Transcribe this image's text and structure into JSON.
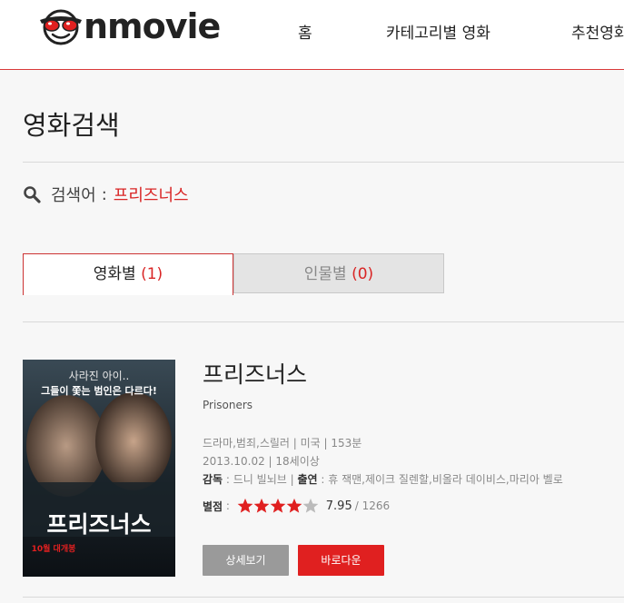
{
  "header": {
    "logo_text": "nmovie",
    "nav": {
      "home": "홈",
      "category": "카테고리별 영화",
      "recommend": "추천영화"
    }
  },
  "page": {
    "title": "영화검색"
  },
  "search": {
    "label": "검색어",
    "separator": ":",
    "term": "프리즈너스"
  },
  "tabs": [
    {
      "label": "영화별",
      "count": "(1)",
      "active": true
    },
    {
      "label": "인물별",
      "count": "(0)",
      "active": false
    }
  ],
  "movie": {
    "title": "프리즈너스",
    "original_title": "Prisoners",
    "info_line": "드라마,범죄,스릴러 | 미국 | 153분",
    "release_line": "2013.10.02 | 18세이상",
    "director_label": "감독",
    "director": " : 드니 빌뇌브 | ",
    "cast_label": "출연",
    "cast": " : 휴 잭맨,제이크 질렌할,비올라 데이비스,마리아 벨로",
    "rating_label": "별점",
    "rating_sep": " : ",
    "stars_filled": 4,
    "stars_total": 5,
    "score": "7.95",
    "votes": "/ 1266",
    "buttons": {
      "detail": "상세보기",
      "download": "바로다운"
    },
    "poster": {
      "tagline1": "사라진 아이..",
      "tagline2": "그들이 쫓는 범인은 다르다!",
      "title": "프리즈너스",
      "date": "10월 대개봉"
    }
  },
  "colors": {
    "accent": "#d92525",
    "star": "#e02020",
    "star_empty": "#bbbbbb"
  }
}
